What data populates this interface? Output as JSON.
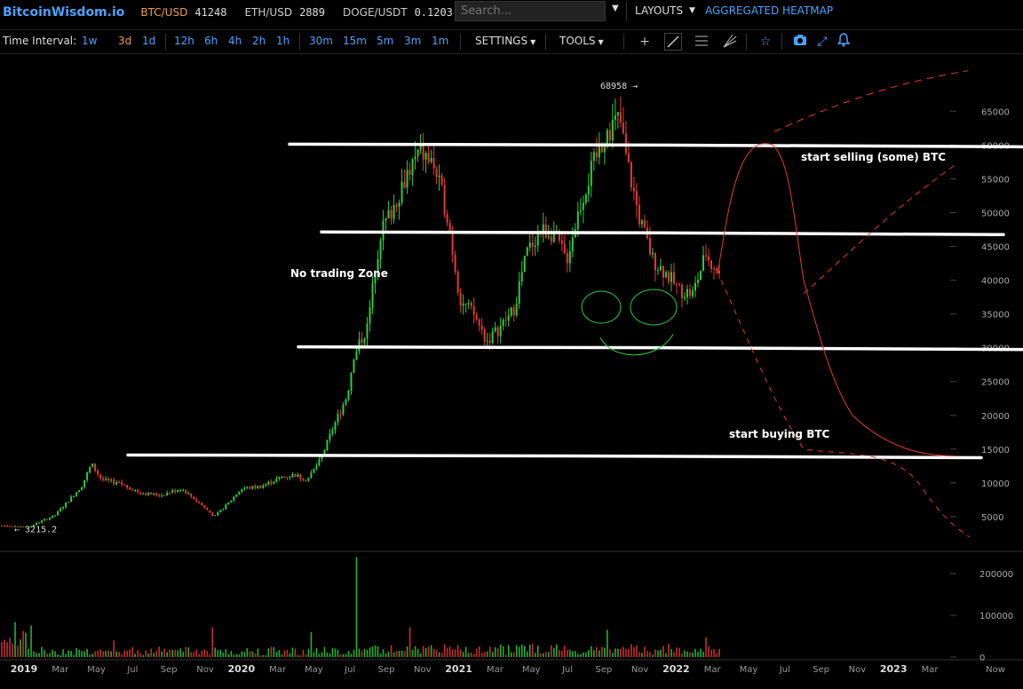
{
  "header": {
    "logo": "BitcoinWisdom.io",
    "tickers": [
      {
        "name": "BTC/USD",
        "price": "41248",
        "color": "#f0a040"
      },
      {
        "name": "ETH/USD",
        "price": "2889",
        "color": "#cccccc"
      },
      {
        "name": "DOGE/USDT",
        "price": "0.1203",
        "color": "#cccccc"
      }
    ],
    "search_placeholder": "Search...",
    "layouts_label": "LAYOUTS",
    "heatmap_label": "AGGREGATED HEATMAP"
  },
  "toolbar": {
    "interval_label": "Time Interval:",
    "intervals": [
      "1w",
      "3d",
      "1d",
      "12h",
      "6h",
      "4h",
      "2h",
      "1h",
      "30m",
      "15m",
      "5m",
      "3m",
      "1m"
    ],
    "active_interval": "3d",
    "settings_label": "SETTINGS",
    "tools_label": "TOOLS",
    "tool_icons": [
      "crosshair-icon",
      "line-tool-icon",
      "hlines-icon",
      "fib-fan-icon",
      "star-icon",
      "camera-icon",
      "fullscreen-icon",
      "bell-icon"
    ]
  },
  "colors": {
    "up": "#2ecc40",
    "down": "#e53935",
    "accent": "#4aa3ff",
    "active": "#f0a040"
  },
  "chart_data": {
    "type": "candlestick",
    "price_axis_ticks": [
      "65000",
      "60000",
      "55000",
      "50000",
      "45000",
      "40000",
      "35000",
      "30000",
      "25000",
      "20000",
      "15000",
      "10000",
      "5000"
    ],
    "price_range": [
      0,
      72000
    ],
    "volume_axis_ticks": [
      "200000",
      "100000",
      "0"
    ],
    "volume_range": [
      0,
      245000
    ],
    "time_labels": [
      "2019",
      "Mar",
      "May",
      "Jul",
      "Sep",
      "Nov",
      "2020",
      "Mar",
      "May",
      "Jul",
      "Sep",
      "Nov",
      "2021",
      "Mar",
      "May",
      "Jul",
      "Sep",
      "Nov",
      "2022",
      "Mar",
      "May",
      "Jul",
      "Sep",
      "Nov",
      "2023",
      "Mar",
      "Now"
    ],
    "low_marker": "← 3215.2",
    "high_marker": "68958 →",
    "annotations": {
      "sell": "start selling (some) BTC",
      "buy": "start buying BTC",
      "zone": "No trading Zone"
    },
    "horizontal_levels": [
      60000,
      47000,
      30000,
      14000
    ],
    "price_path": [
      [
        0,
        3700
      ],
      [
        0.08,
        3500
      ],
      [
        0.16,
        5200
      ],
      [
        0.24,
        9500
      ],
      [
        0.27,
        12800
      ],
      [
        0.3,
        10500
      ],
      [
        0.36,
        9800
      ],
      [
        0.42,
        8500
      ],
      [
        0.48,
        8200
      ],
      [
        0.54,
        9200
      ],
      [
        0.6,
        6800
      ],
      [
        0.64,
        5000
      ],
      [
        0.68,
        6900
      ],
      [
        0.72,
        9100
      ],
      [
        0.78,
        9500
      ],
      [
        0.84,
        10800
      ],
      [
        0.88,
        11200
      ],
      [
        0.92,
        10500
      ],
      [
        0.96,
        13500
      ],
      [
        1.0,
        18500
      ],
      [
        1.04,
        23000
      ],
      [
        1.06,
        29000
      ],
      [
        1.1,
        33000
      ],
      [
        1.14,
        47000
      ],
      [
        1.18,
        51000
      ],
      [
        1.22,
        56000
      ],
      [
        1.26,
        59000
      ],
      [
        1.3,
        57000
      ],
      [
        1.34,
        50000
      ],
      [
        1.38,
        37000
      ],
      [
        1.42,
        35000
      ],
      [
        1.46,
        31000
      ],
      [
        1.5,
        33000
      ],
      [
        1.54,
        35500
      ],
      [
        1.58,
        44000
      ],
      [
        1.62,
        47500
      ],
      [
        1.66,
        47000
      ],
      [
        1.7,
        43000
      ],
      [
        1.74,
        51000
      ],
      [
        1.78,
        57000
      ],
      [
        1.82,
        62000
      ],
      [
        1.86,
        64000
      ],
      [
        1.88,
        58000
      ],
      [
        1.92,
        49000
      ],
      [
        1.96,
        43000
      ],
      [
        2.0,
        41000
      ],
      [
        2.04,
        38500
      ],
      [
        2.08,
        38000
      ],
      [
        2.12,
        44000
      ],
      [
        2.16,
        41000
      ]
    ]
  }
}
